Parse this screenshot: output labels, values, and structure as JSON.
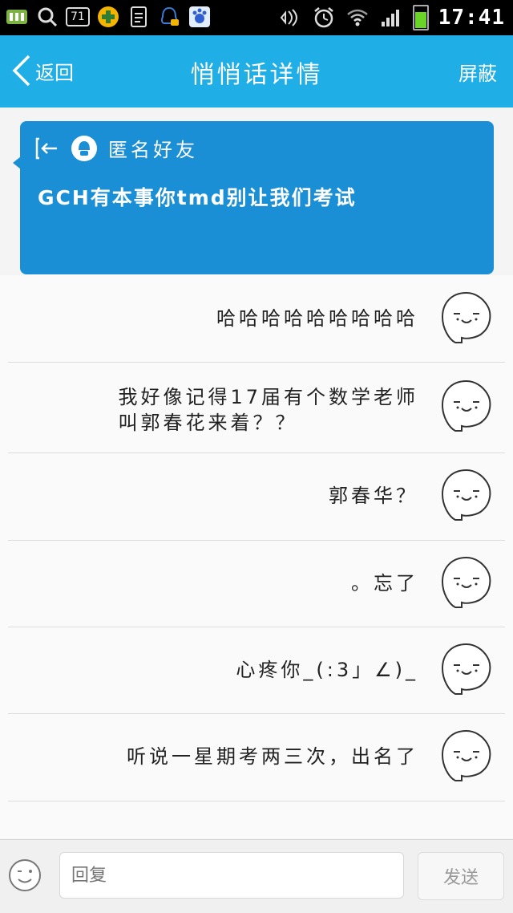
{
  "status_bar": {
    "badge": "71",
    "time": "17:41"
  },
  "nav": {
    "back_label": "返回",
    "title": "悄悄话详情",
    "block_label": "屏蔽"
  },
  "card": {
    "sender": "匿名好友",
    "message": "GCH有本事你tmd别让我们考试"
  },
  "replies": [
    {
      "lines": [
        "哈哈哈哈哈哈哈哈哈"
      ]
    },
    {
      "lines": [
        "我好像记得17届有个数学老师",
        "叫郭春花来着？？"
      ]
    },
    {
      "lines": [
        "郭春华？"
      ]
    },
    {
      "lines": [
        "。忘了"
      ]
    },
    {
      "lines": [
        "心疼你_(:3」∠)_"
      ]
    },
    {
      "lines": [
        "听说一星期考两三次，出名了"
      ]
    }
  ],
  "composer": {
    "placeholder": "回复",
    "send_label": "发送"
  },
  "colors": {
    "nav_bg": "#1faee6",
    "card_bg": "#1b8fd6"
  }
}
